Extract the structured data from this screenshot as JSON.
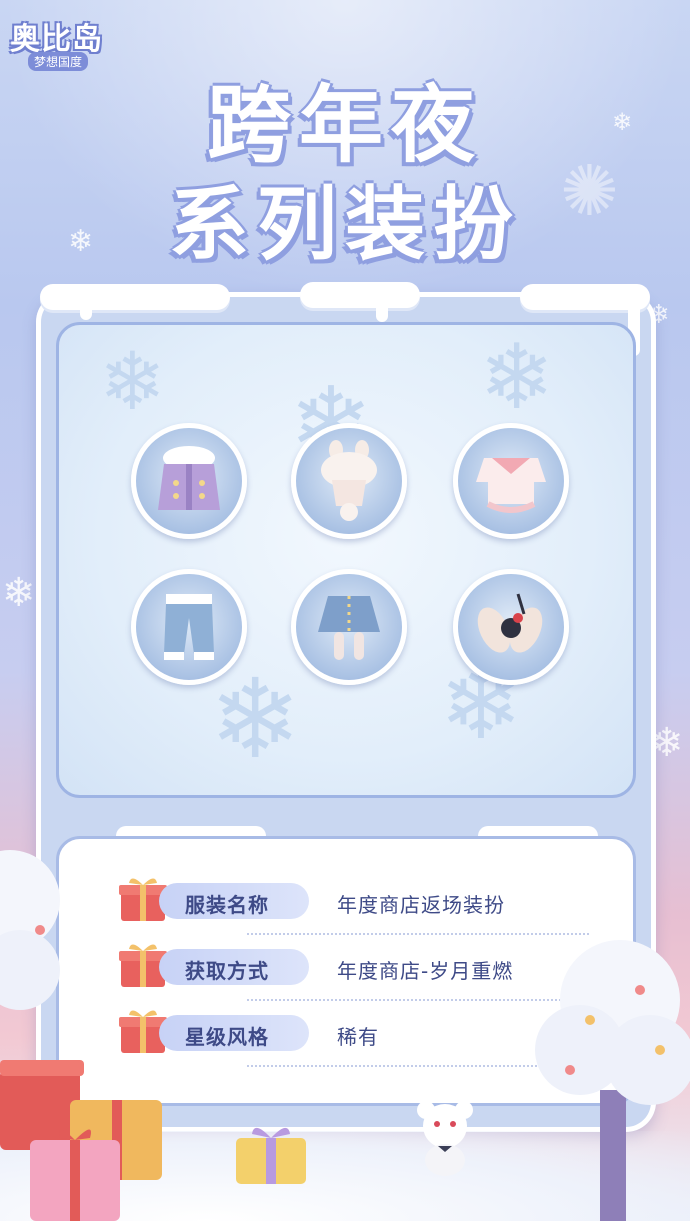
{
  "logo": {
    "main": "奥比岛",
    "sub": "梦想国度"
  },
  "title": {
    "line1": "跨年夜",
    "line2": "系列装扮"
  },
  "items": [
    {
      "name": "jacket-item",
      "icon": "purple-fur-jacket"
    },
    {
      "name": "hat-item",
      "icon": "bunny-ear-hat"
    },
    {
      "name": "dress-top-item",
      "icon": "pink-bow-top"
    },
    {
      "name": "pants-item",
      "icon": "denim-pants"
    },
    {
      "name": "skirt-item",
      "icon": "denim-skirt"
    },
    {
      "name": "earmuff-item",
      "icon": "bunny-earmuff-accessory"
    }
  ],
  "info": {
    "rows": [
      {
        "label": "服装名称",
        "value": "年度商店返场装扮"
      },
      {
        "label": "获取方式",
        "value": "年度商店-岁月重燃"
      },
      {
        "label": "星级风格",
        "value": "稀有"
      }
    ]
  },
  "colors": {
    "title_outline": "#8f9fe0",
    "panel_border": "#9eb4e4",
    "text": "#3e4a87",
    "gift": "#e8615e"
  }
}
